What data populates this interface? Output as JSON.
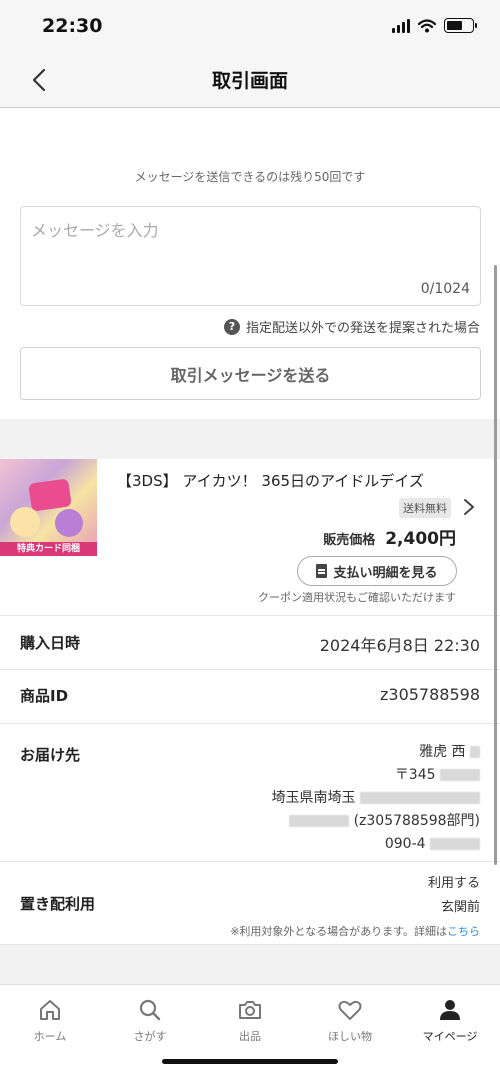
{
  "status_bar": {
    "time": "22:30"
  },
  "header": {
    "title": "取引画面"
  },
  "message": {
    "remaining_text": "メッセージを送信できるのは残り50回です",
    "placeholder": "メッセージを入力",
    "counter": "0/1024",
    "help_text": "指定配送以外での発送を提案された場合",
    "help_icon_glyph": "?",
    "send_label": "取引メッセージを送る"
  },
  "product": {
    "thumbnail_ribbon": "特典カード同梱",
    "title": "【3DS】 アイカツ！ 365日のアイドルデイズ",
    "shipping_badge": "送料無料",
    "price_label": "販売価格",
    "price_value": "2,400円",
    "detail_button": "支払い明細を見る",
    "coupon_note": "クーポン適用状況もご確認いただけます"
  },
  "purchase_date": {
    "label": "購入日時",
    "value": "2024年6月8日 22:30"
  },
  "product_id": {
    "label": "商品ID",
    "value": "z305788598"
  },
  "delivery": {
    "label": "お届け先",
    "name": "雅虎 西",
    "postal": "〒345",
    "address": "埼玉県南埼玉",
    "id_line": "(z305788598部門)",
    "phone": "090-4"
  },
  "okihai": {
    "label": "置き配利用",
    "status": "利用する",
    "location": "玄関前",
    "note": "※利用対象外となる場合があります。詳細は",
    "link": "こちら"
  },
  "tabs": [
    {
      "label": "ホーム",
      "icon": "home-icon"
    },
    {
      "label": "さがす",
      "icon": "search-icon"
    },
    {
      "label": "出品",
      "icon": "camera-icon"
    },
    {
      "label": "ほしい物",
      "icon": "heart-icon"
    },
    {
      "label": "マイページ",
      "icon": "person-icon"
    }
  ]
}
